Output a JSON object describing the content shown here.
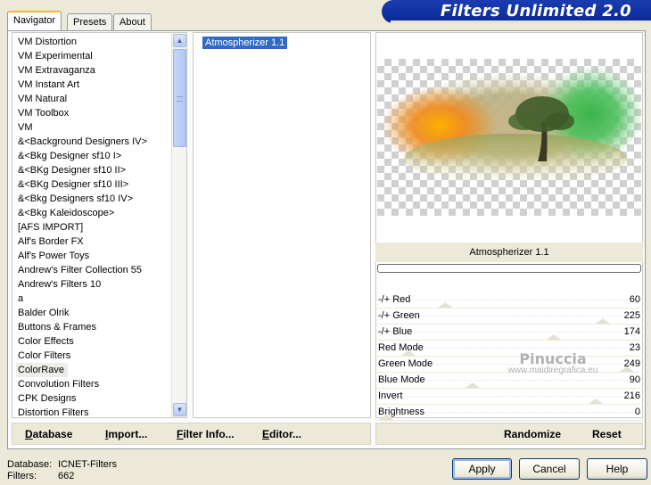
{
  "app": {
    "title": "Filters Unlimited 2.0"
  },
  "tabs": [
    {
      "label": "Navigator",
      "active": true
    },
    {
      "label": "Presets",
      "active": false
    },
    {
      "label": "About",
      "active": false
    }
  ],
  "categories": {
    "items": [
      "VM Distortion",
      "VM Experimental",
      "VM Extravaganza",
      "VM Instant Art",
      "VM Natural",
      "VM Toolbox",
      "VM",
      "&<Background Designers IV>",
      "&<Bkg Designer sf10 I>",
      "&<BKg Designer sf10 II>",
      "&<BKg Designer sf10 III>",
      "&<Bkg Designers sf10 IV>",
      "&<Bkg Kaleidoscope>",
      "[AFS IMPORT]",
      "Alf's Border FX",
      "Alf's Power Toys",
      "Andrew's Filter Collection 55",
      "Andrew's Filters 10",
      "a",
      "Balder Olrik",
      "Buttons & Frames",
      "Color Effects",
      "Color Filters",
      "ColorRave",
      "Convolution Filters",
      "CPK Designs",
      "Distortion Filters"
    ],
    "selected": "ColorRave"
  },
  "filters": {
    "items": [
      "Atmospherizer 1.1"
    ],
    "selected": "Atmospherizer 1.1"
  },
  "preview": {
    "filter_name": "Atmospherizer 1.1",
    "progress": 0
  },
  "watermark": {
    "line1": "Pinuccia",
    "line2": "www.maidiregrafica.eu"
  },
  "sliders": [
    {
      "label": "-/+ Red",
      "value": "60",
      "level": 0.24
    },
    {
      "label": "-/+ Green",
      "value": "225",
      "level": 0.88
    },
    {
      "label": "-/+ Blue",
      "value": "174",
      "level": 0.68
    },
    {
      "label": "Red Mode",
      "value": "23",
      "level": 0.09
    },
    {
      "label": "Green Mode",
      "value": "249",
      "level": 0.98
    },
    {
      "label": "Blue Mode",
      "value": "90",
      "level": 0.35
    },
    {
      "label": "Invert",
      "value": "216",
      "level": 0.85
    },
    {
      "label": "Brightness",
      "value": "0",
      "level": 0.0
    }
  ],
  "left_buttons": {
    "database": {
      "label": "Database",
      "ul": "D",
      "rest": "atabase"
    },
    "import": {
      "label": "Import...",
      "ul": "I",
      "rest": "mport..."
    },
    "filter_info": {
      "label": "Filter Info...",
      "ul": "F",
      "rest": "ilter Info..."
    },
    "editor": {
      "label": "Editor...",
      "ul": "E",
      "rest": "ditor..."
    }
  },
  "right_buttons": {
    "randomize": "Randomize",
    "reset": "Reset"
  },
  "status": {
    "database_label": "Database:",
    "database_value": "ICNET-Filters",
    "filters_label": "Filters:",
    "filters_value": "662"
  },
  "dialog_buttons": {
    "apply": "Apply",
    "cancel": "Cancel",
    "help": "Help"
  }
}
